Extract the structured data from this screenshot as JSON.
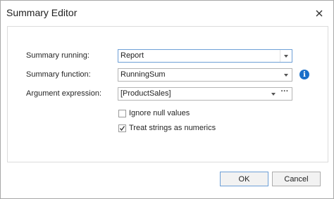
{
  "dialog": {
    "title": "Summary Editor",
    "close_glyph": "✕"
  },
  "form": {
    "summary_running": {
      "label": "Summary running:",
      "value": "Report"
    },
    "summary_function": {
      "label": "Summary function:",
      "value": "RunningSum"
    },
    "argument_expression": {
      "label": "Argument expression:",
      "value": "[ProductSales]",
      "ellipsis": "···"
    },
    "info_glyph": "i",
    "ignore_null_values": {
      "label": "Ignore null values",
      "checked": false
    },
    "treat_strings_as_numerics": {
      "label": "Treat strings as numerics",
      "checked": true
    }
  },
  "buttons": {
    "ok": "OK",
    "cancel": "Cancel"
  },
  "colors": {
    "accent": "#1a6fc9",
    "focus_border": "#6d9fd6"
  },
  "icons": [
    "close-icon",
    "dropdown-arrow-icon",
    "ellipsis-icon",
    "info-icon",
    "checkmark-icon"
  ]
}
